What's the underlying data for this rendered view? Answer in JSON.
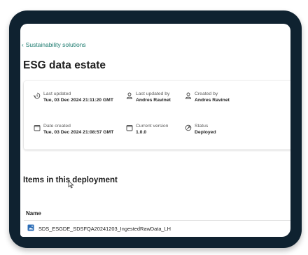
{
  "breadcrumb": {
    "back_label": "Sustainability solutions"
  },
  "page": {
    "title": "ESG data estate"
  },
  "details": {
    "last_updated": {
      "label": "Last updated",
      "value": "Tue, 03 Dec 2024 21:11:20 GMT",
      "icon": "history-icon"
    },
    "last_updated_by": {
      "label": "Last updated by",
      "value": "Andres Ravinet",
      "icon": "person-icon"
    },
    "created_by": {
      "label": "Created by",
      "value": "Andres Ravinet",
      "icon": "person-icon"
    },
    "date_created": {
      "label": "Date created",
      "value": "Tue, 03 Dec 2024 21:08:57 GMT",
      "icon": "calendar-icon"
    },
    "current_version": {
      "label": "Current version",
      "value": "1.0.0",
      "icon": "calendar-icon"
    },
    "status": {
      "label": "Status",
      "value": "Deployed",
      "icon": "status-icon"
    }
  },
  "items_section": {
    "title": "Items in this deployment",
    "columns": [
      "Name"
    ],
    "rows": [
      {
        "name": "SDS_ESGDE_SDSFQA20241203_IngestedRawData_LH",
        "icon": "lakehouse-icon"
      }
    ]
  },
  "colors": {
    "frame": "#0f2230",
    "link": "#1b7a6e",
    "item_icon": "#2c6db6"
  }
}
